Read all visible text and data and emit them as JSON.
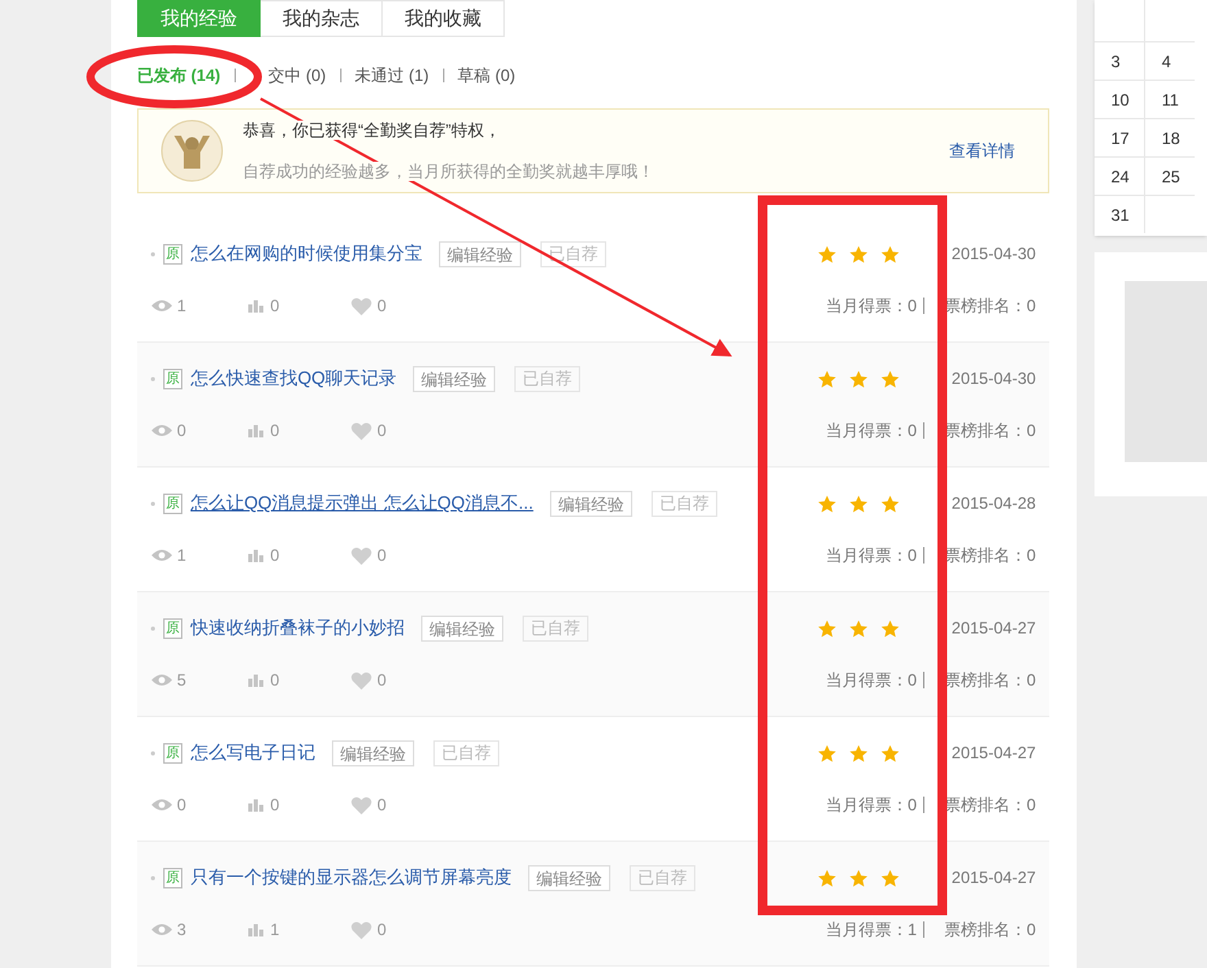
{
  "tabs": [
    {
      "label": "我的经验",
      "selected": true
    },
    {
      "label": "我的杂志",
      "selected": false
    },
    {
      "label": "我的收藏",
      "selected": false
    }
  ],
  "subtabs": [
    {
      "label": "已发布 (14)",
      "selected": true
    },
    {
      "label": "交中 (0)",
      "selected": false
    },
    {
      "label": "未通过 (1)",
      "selected": false
    },
    {
      "label": "草稿 (0)",
      "selected": false
    }
  ],
  "notice": {
    "title": "恭喜，你已获得“全勤奖自荐”特权，",
    "text": "自荐成功的经验越多，当月所获得的全勤奖就越丰厚哦！",
    "link": "查看详情"
  },
  "articles": [
    {
      "badge": "原",
      "title": "怎么在网购的时候使用集分宝",
      "underlined": false,
      "edit": "编辑经验",
      "status": "已自荐",
      "stars": 3,
      "date": "2015-04-30",
      "views": "1",
      "votes": "0",
      "likes": "0",
      "month_votes": "当月得票：0",
      "rank": "票榜排名：0"
    },
    {
      "badge": "原",
      "title": "怎么快速查找QQ聊天记录",
      "underlined": false,
      "edit": "编辑经验",
      "status": "已自荐",
      "stars": 3,
      "date": "2015-04-30",
      "views": "0",
      "votes": "0",
      "likes": "0",
      "month_votes": "当月得票：0",
      "rank": "票榜排名：0"
    },
    {
      "badge": "原",
      "title": "怎么让QQ消息提示弹出 怎么让QQ消息不...",
      "underlined": true,
      "edit": "编辑经验",
      "status": "已自荐",
      "stars": 3,
      "date": "2015-04-28",
      "views": "1",
      "votes": "0",
      "likes": "0",
      "month_votes": "当月得票：0",
      "rank": "票榜排名：0"
    },
    {
      "badge": "原",
      "title": "快速收纳折叠袜子的小妙招",
      "underlined": false,
      "edit": "编辑经验",
      "status": "已自荐",
      "stars": 3,
      "date": "2015-04-27",
      "views": "5",
      "votes": "0",
      "likes": "0",
      "month_votes": "当月得票：0",
      "rank": "票榜排名：0"
    },
    {
      "badge": "原",
      "title": "怎么写电子日记",
      "underlined": false,
      "edit": "编辑经验",
      "status": "已自荐",
      "stars": 3,
      "date": "2015-04-27",
      "views": "0",
      "votes": "0",
      "likes": "0",
      "month_votes": "当月得票：0",
      "rank": "票榜排名：0"
    },
    {
      "badge": "原",
      "title": "只有一个按键的显示器怎么调节屏幕亮度",
      "underlined": false,
      "edit": "编辑经验",
      "status": "已自荐",
      "stars": 3,
      "date": "2015-04-27",
      "views": "3",
      "votes": "1",
      "likes": "0",
      "month_votes": "当月得票：1",
      "rank": "票榜排名：0"
    }
  ],
  "calendar": {
    "rows": [
      [
        "",
        ""
      ],
      [
        "3",
        "4"
      ],
      [
        "10",
        "11"
      ],
      [
        "17",
        "18"
      ],
      [
        "24",
        "25"
      ],
      [
        "31",
        ""
      ]
    ]
  }
}
